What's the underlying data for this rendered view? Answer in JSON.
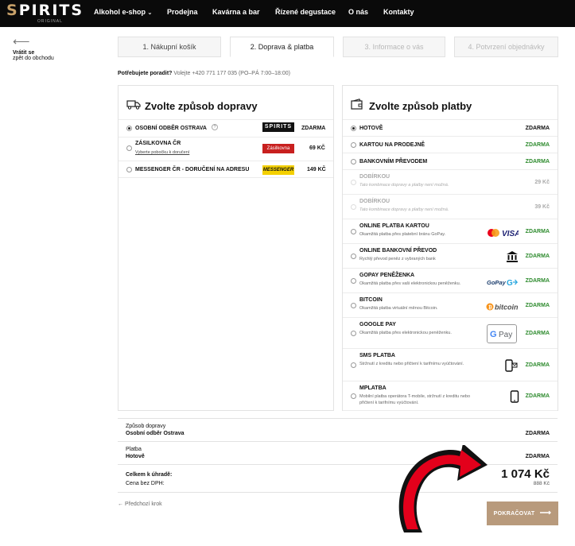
{
  "header": {
    "logo_text": "SPIRITS",
    "logo_sub": "ORIGINAL",
    "nav": [
      "Alkohol e-shop",
      "Prodejna",
      "Kavárna a bar",
      "Řízené degustace",
      "O nás",
      "Kontakty"
    ]
  },
  "back": {
    "line1": "Vrátit se",
    "line2": "zpět do obchodu"
  },
  "tabs": [
    "1. Nákupní košík",
    "2. Doprava & platba",
    "3. Informace o vás",
    "4. Potvrzení objednávky"
  ],
  "help": {
    "bold": "Potřebujete poradit?",
    "text": "Volejte +420 771 177 035 (PO–PÁ 7:00–18:00)"
  },
  "shipping": {
    "title": "Zvolte způsob dopravy",
    "options": [
      {
        "label": "OSOBNÍ ODBĚR OSTRAVA",
        "desc": "",
        "price": "ZDARMA",
        "logo": "SPIRITS",
        "selected": true
      },
      {
        "label": "ZÁSILKOVNA ČR",
        "desc": "Vyberte pobočku k doručení",
        "price": "69 KČ",
        "logo": "Zásilkovna",
        "selected": false
      },
      {
        "label": "MESSENGER ČR - DORUČENÍ NA ADRESU",
        "desc": "",
        "price": "149 KČ",
        "logo": "MESSENGER",
        "selected": false
      }
    ]
  },
  "payment": {
    "title": "Zvolte způsob platby",
    "options": [
      {
        "label": "HOTOVĚ",
        "desc": "",
        "price": "ZDARMA",
        "price_color": "#111111",
        "selected": true,
        "disabled": false,
        "logo": ""
      },
      {
        "label": "KARTOU NA PRODEJNĚ",
        "desc": "",
        "price": "ZDARMA",
        "price_color": "#2e8b2e",
        "selected": false,
        "disabled": false,
        "logo": ""
      },
      {
        "label": "BANKOVNÍM PŘEVODEM",
        "desc": "",
        "price": "ZDARMA",
        "price_color": "#2e8b2e",
        "selected": false,
        "disabled": false,
        "logo": ""
      },
      {
        "label": "DOBÍRKOU",
        "desc": "Tato kombinace dopravy a platby není možná.",
        "price": "29 Kč",
        "price_color": "#aaaaaa",
        "selected": false,
        "disabled": true,
        "logo": ""
      },
      {
        "label": "DOBÍRKOU",
        "desc": "Tato kombinace dopravy a platby není možná.",
        "price": "39 Kč",
        "price_color": "#aaaaaa",
        "selected": false,
        "disabled": true,
        "logo": ""
      },
      {
        "label": "ONLINE PLATBA KARTOU",
        "desc": "Okamžitá platba přes platební bránu GoPay.",
        "price": "ZDARMA",
        "price_color": "#2e8b2e",
        "selected": false,
        "disabled": false,
        "logo": "VISA"
      },
      {
        "label": "ONLINE BANKOVNÍ PŘEVOD",
        "desc": "Rychlý převod peněz z vybraných bank",
        "price": "ZDARMA",
        "price_color": "#2e8b2e",
        "selected": false,
        "disabled": false,
        "logo": "bank-icon"
      },
      {
        "label": "GOPAY PENĚŽENKA",
        "desc": "Okamžitá platba přes vaši elektronickou peněženku.",
        "price": "ZDARMA",
        "price_color": "#2e8b2e",
        "selected": false,
        "disabled": false,
        "logo": "GoPay"
      },
      {
        "label": "BITCOIN",
        "desc": "Okamžitá platba virtuální měnou Bitcoin.",
        "price": "ZDARMA",
        "price_color": "#2e8b2e",
        "selected": false,
        "disabled": false,
        "logo": "bitcoin"
      },
      {
        "label": "GOOGLE PAY",
        "desc": "Okamžitá platba přes elektronickou peněženku.",
        "price": "ZDARMA",
        "price_color": "#2e8b2e",
        "selected": false,
        "disabled": false,
        "logo": "G Pay"
      },
      {
        "label": "SMS PLATBA",
        "desc": "Stržnutí z kreditu nebo přičtení k tarifnímu vyúčtování.",
        "price": "ZDARMA",
        "price_color": "#2e8b2e",
        "selected": false,
        "disabled": false,
        "logo": "sms-phone-icon"
      },
      {
        "label": "MPLATBA",
        "desc": "Mobilní platba operátora T-mobile, stržnutí z kreditu nebo přičtení k tarifnímu vyúčtování.",
        "price": "ZDARMA",
        "price_color": "#2e8b2e",
        "selected": false,
        "disabled": false,
        "logo": "phone-icon"
      }
    ]
  },
  "summary": {
    "shipping_label": "Způsob dopravy",
    "shipping_value": "Osobní odběr Ostrava",
    "shipping_price": "ZDARMA",
    "payment_label": "Platba",
    "payment_value": "Hotově",
    "payment_price": "ZDARMA",
    "total_label": "Celkem k úhradě:",
    "total_value": "1 074 Kč",
    "net_label": "Cena bez DPH:",
    "net_value": "888 Kč"
  },
  "actions": {
    "prev": "← Předchozí krok",
    "continue": "POKRAČOVAT"
  },
  "colors": {
    "topbar": "#0a0a0a",
    "accent": "#b89a7c",
    "green": "#2e8b2e"
  }
}
